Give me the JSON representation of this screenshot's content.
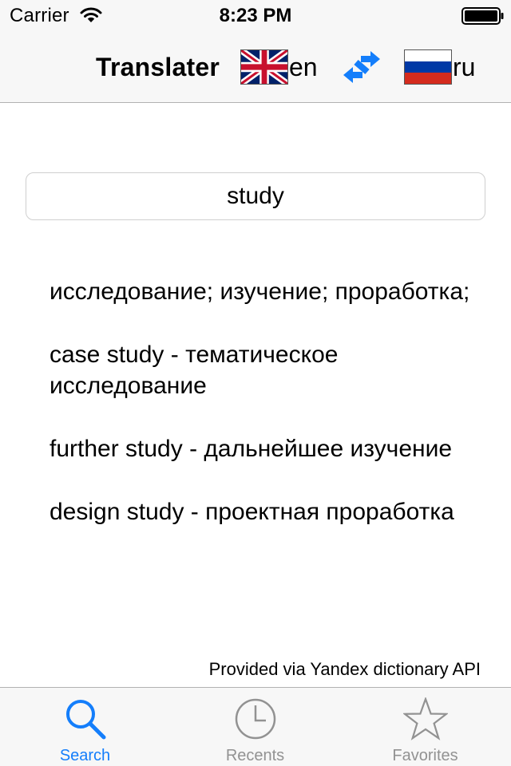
{
  "status_bar": {
    "carrier": "Carrier",
    "time": "8:23 PM",
    "icons": [
      "wifi-icon",
      "battery-icon"
    ]
  },
  "nav": {
    "title": "Translater",
    "source_lang": "en",
    "target_lang": "ru",
    "source_flag": "uk-flag-icon",
    "target_flag": "russia-flag-icon",
    "swap_icon": "swap-arrows-icon",
    "accent_color": "#147efb"
  },
  "search": {
    "value": "study",
    "placeholder": ""
  },
  "results": [
    "исследование; изучение; проработка;",
    "case study - тематическое исследование",
    "further study - дальнейшее изучение",
    "design study - проектная проработка"
  ],
  "provider_note": "Provided via Yandex dictionary API",
  "tabs": [
    {
      "label": "Search",
      "icon": "search-icon",
      "active": true
    },
    {
      "label": "Recents",
      "icon": "clock-icon",
      "active": false
    },
    {
      "label": "Favorites",
      "icon": "star-icon",
      "active": false
    }
  ]
}
